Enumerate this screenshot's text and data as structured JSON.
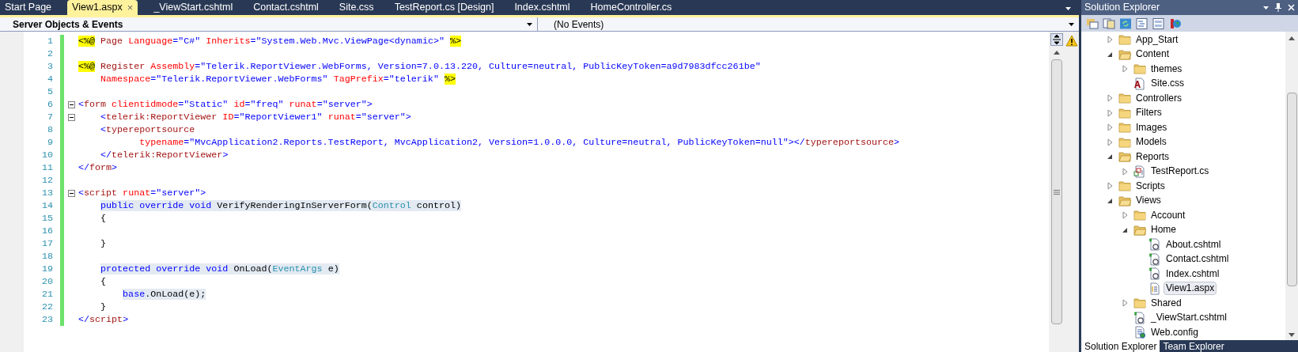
{
  "document_tabs": [
    {
      "label": "Start Page",
      "selected": false
    },
    {
      "label": "View1.aspx",
      "selected": true,
      "close": "×"
    },
    {
      "label": "_ViewStart.cshtml",
      "selected": false
    },
    {
      "label": "Contact.cshtml",
      "selected": false
    },
    {
      "label": "Site.css",
      "selected": false
    },
    {
      "label": "TestReport.cs [Design]",
      "selected": false
    },
    {
      "label": "Index.cshtml",
      "selected": false
    },
    {
      "label": "HomeController.cs",
      "selected": false
    }
  ],
  "object_dropdown": {
    "value": "Server Objects & Events"
  },
  "event_dropdown": {
    "value": "(No Events)"
  },
  "code_lines": [
    {
      "number": "1",
      "fold": false,
      "highlighted": false,
      "tokens": [
        {
          "kind": "directive",
          "text": "<%@"
        },
        {
          "kind": "tag",
          "text": " Page"
        },
        {
          "kind": "attr",
          "text": " Language"
        },
        {
          "kind": "value",
          "text": "=\"C#\""
        },
        {
          "kind": "attr",
          "text": " Inherits"
        },
        {
          "kind": "value",
          "text": "=\"System.Web.Mvc.ViewPage<dynamic>\" "
        },
        {
          "kind": "directive",
          "text": "%>"
        }
      ]
    },
    {
      "number": "2",
      "fold": false,
      "highlighted": false
    },
    {
      "number": "3",
      "fold": false,
      "highlighted": false,
      "tokens": [
        {
          "kind": "directive",
          "text": "<%@"
        },
        {
          "kind": "tag",
          "text": " Register"
        },
        {
          "kind": "attr",
          "text": " Assembly"
        },
        {
          "kind": "value",
          "text": "=\"Telerik.ReportViewer.WebForms, Version=7.0.13.220, Culture=neutral, PublicKeyToken=a9d7983dfcc261be\""
        }
      ]
    },
    {
      "number": "4",
      "fold": false,
      "highlighted": false,
      "tokens": [
        {
          "kind": "attr",
          "text": "    Namespace"
        },
        {
          "kind": "value",
          "text": "=\"Telerik.ReportViewer.WebForms\""
        },
        {
          "kind": "attr",
          "text": " TagPrefix"
        },
        {
          "kind": "value",
          "text": "=\"telerik\" "
        },
        {
          "kind": "directive",
          "text": "%>"
        }
      ]
    },
    {
      "number": "5",
      "fold": false,
      "highlighted": false
    },
    {
      "number": "6",
      "fold": true,
      "highlighted": false,
      "tokens": [
        {
          "kind": "delim",
          "text": "<"
        },
        {
          "kind": "tag",
          "text": "form"
        },
        {
          "kind": "attr",
          "text": " clientidmode"
        },
        {
          "kind": "value",
          "text": "=\"Static\""
        },
        {
          "kind": "attr",
          "text": " id"
        },
        {
          "kind": "value",
          "text": "=\"freq\""
        },
        {
          "kind": "attr",
          "text": " runat"
        },
        {
          "kind": "value",
          "text": "=\"server\">"
        }
      ]
    },
    {
      "number": "7",
      "fold": true,
      "highlighted": false,
      "tokens": [
        {
          "kind": "delim",
          "text": "    <"
        },
        {
          "kind": "tag",
          "text": "telerik:ReportViewer"
        },
        {
          "kind": "attr",
          "text": " ID"
        },
        {
          "kind": "value",
          "text": "=\"ReportViewer1\""
        },
        {
          "kind": "attr",
          "text": " runat"
        },
        {
          "kind": "value",
          "text": "=\"server\">"
        }
      ]
    },
    {
      "number": "8",
      "fold": false,
      "highlighted": false,
      "tokens": [
        {
          "kind": "delim",
          "text": "    <"
        },
        {
          "kind": "tag",
          "text": "typereportsource"
        }
      ]
    },
    {
      "number": "9",
      "fold": false,
      "highlighted": false,
      "tokens": [
        {
          "kind": "attr",
          "text": "           typename"
        },
        {
          "kind": "value",
          "text": "=\"MvcApplication2.Reports.TestReport, MvcApplication2, Version=1.0.0.0, Culture=neutral, PublicKeyToken=null\"></"
        },
        {
          "kind": "tag",
          "text": "typereportsource"
        },
        {
          "kind": "delim",
          "text": ">"
        }
      ]
    },
    {
      "number": "10",
      "fold": false,
      "highlighted": false,
      "tokens": [
        {
          "kind": "delim",
          "text": "    </"
        },
        {
          "kind": "tag",
          "text": "telerik:ReportViewer"
        },
        {
          "kind": "delim",
          "text": ">"
        }
      ]
    },
    {
      "number": "11",
      "fold": false,
      "highlighted": false,
      "tokens": [
        {
          "kind": "delim",
          "text": "</"
        },
        {
          "kind": "tag",
          "text": "form"
        },
        {
          "kind": "delim",
          "text": ">"
        }
      ]
    },
    {
      "number": "12",
      "fold": false,
      "highlighted": false
    },
    {
      "number": "13",
      "fold": true,
      "highlighted": false,
      "tokens": [
        {
          "kind": "delim",
          "text": "<"
        },
        {
          "kind": "tag",
          "text": "script"
        },
        {
          "kind": "attr",
          "text": " runat"
        },
        {
          "kind": "value",
          "text": "=\"server\">"
        }
      ]
    },
    {
      "number": "14",
      "fold": false,
      "highlighted": true,
      "tokens": [
        {
          "kind": "keyword",
          "text": "    public override void"
        },
        {
          "kind": "plain",
          "text": " VerifyRenderingInServerForm("
        },
        {
          "kind": "type",
          "text": "Control"
        },
        {
          "kind": "plain",
          "text": " control)"
        }
      ]
    },
    {
      "number": "15",
      "fold": false,
      "highlighted": false,
      "tokens": [
        {
          "kind": "plain",
          "text": "    {"
        }
      ]
    },
    {
      "number": "16",
      "fold": false,
      "highlighted": false
    },
    {
      "number": "17",
      "fold": false,
      "highlighted": false,
      "tokens": [
        {
          "kind": "plain",
          "text": "    }"
        }
      ]
    },
    {
      "number": "18",
      "fold": false,
      "highlighted": false
    },
    {
      "number": "19",
      "fold": false,
      "highlighted": true,
      "tokens": [
        {
          "kind": "keyword",
          "text": "    protected override void"
        },
        {
          "kind": "plain",
          "text": " OnLoad("
        },
        {
          "kind": "type",
          "text": "EventArgs"
        },
        {
          "kind": "plain",
          "text": " e)"
        }
      ]
    },
    {
      "number": "20",
      "fold": false,
      "highlighted": false,
      "tokens": [
        {
          "kind": "plain",
          "text": "    {"
        }
      ]
    },
    {
      "number": "21",
      "fold": false,
      "highlighted": true,
      "tokens": [
        {
          "kind": "keyword",
          "text": "        base"
        },
        {
          "kind": "plain",
          "text": ".OnLoad(e);"
        }
      ]
    },
    {
      "number": "22",
      "fold": false,
      "highlighted": false,
      "tokens": [
        {
          "kind": "plain",
          "text": "    }"
        }
      ]
    },
    {
      "number": "23",
      "fold": false,
      "highlighted": false,
      "tokens": [
        {
          "kind": "delim",
          "text": "</"
        },
        {
          "kind": "tag",
          "text": "script"
        },
        {
          "kind": "delim",
          "text": ">"
        }
      ]
    }
  ],
  "solution_explorer": {
    "title": "Solution Explorer",
    "tree": [
      {
        "label": "App_Start",
        "kind": "folder",
        "expanded": false,
        "selected": false
      },
      {
        "label": "Content",
        "kind": "folder",
        "expanded": true,
        "selected": false,
        "children": [
          {
            "label": "themes",
            "kind": "folder",
            "expanded": false,
            "selected": false
          },
          {
            "label": "Site.css",
            "kind": "css",
            "selected": false
          }
        ]
      },
      {
        "label": "Controllers",
        "kind": "folder",
        "expanded": false,
        "selected": false
      },
      {
        "label": "Filters",
        "kind": "folder",
        "expanded": false,
        "selected": false
      },
      {
        "label": "Images",
        "kind": "folder",
        "expanded": false,
        "selected": false
      },
      {
        "label": "Models",
        "kind": "folder",
        "expanded": false,
        "selected": false
      },
      {
        "label": "Reports",
        "kind": "folder",
        "expanded": true,
        "selected": false,
        "children": [
          {
            "label": "TestReport.cs",
            "kind": "report",
            "expanded": false,
            "selected": false
          }
        ]
      },
      {
        "label": "Scripts",
        "kind": "folder",
        "expanded": false,
        "selected": false
      },
      {
        "label": "Views",
        "kind": "folder",
        "expanded": true,
        "selected": false,
        "children": [
          {
            "label": "Account",
            "kind": "folder",
            "expanded": false,
            "selected": false
          },
          {
            "label": "Home",
            "kind": "folder",
            "expanded": true,
            "selected": false,
            "children": [
              {
                "label": "About.cshtml",
                "kind": "razor",
                "selected": false
              },
              {
                "label": "Contact.cshtml",
                "kind": "razor",
                "selected": false
              },
              {
                "label": "Index.cshtml",
                "kind": "razor",
                "selected": false
              },
              {
                "label": "View1.aspx",
                "kind": "aspx",
                "selected": true
              }
            ]
          },
          {
            "label": "Shared",
            "kind": "folder",
            "expanded": false,
            "selected": false
          },
          {
            "label": "_ViewStart.cshtml",
            "kind": "razor",
            "selected": false
          },
          {
            "label": "Web.config",
            "kind": "config",
            "selected": false
          }
        ]
      }
    ],
    "bottom_tabs": [
      {
        "label": "Solution Explorer",
        "selected": true
      },
      {
        "label": "Team Explorer",
        "selected": false
      }
    ]
  }
}
